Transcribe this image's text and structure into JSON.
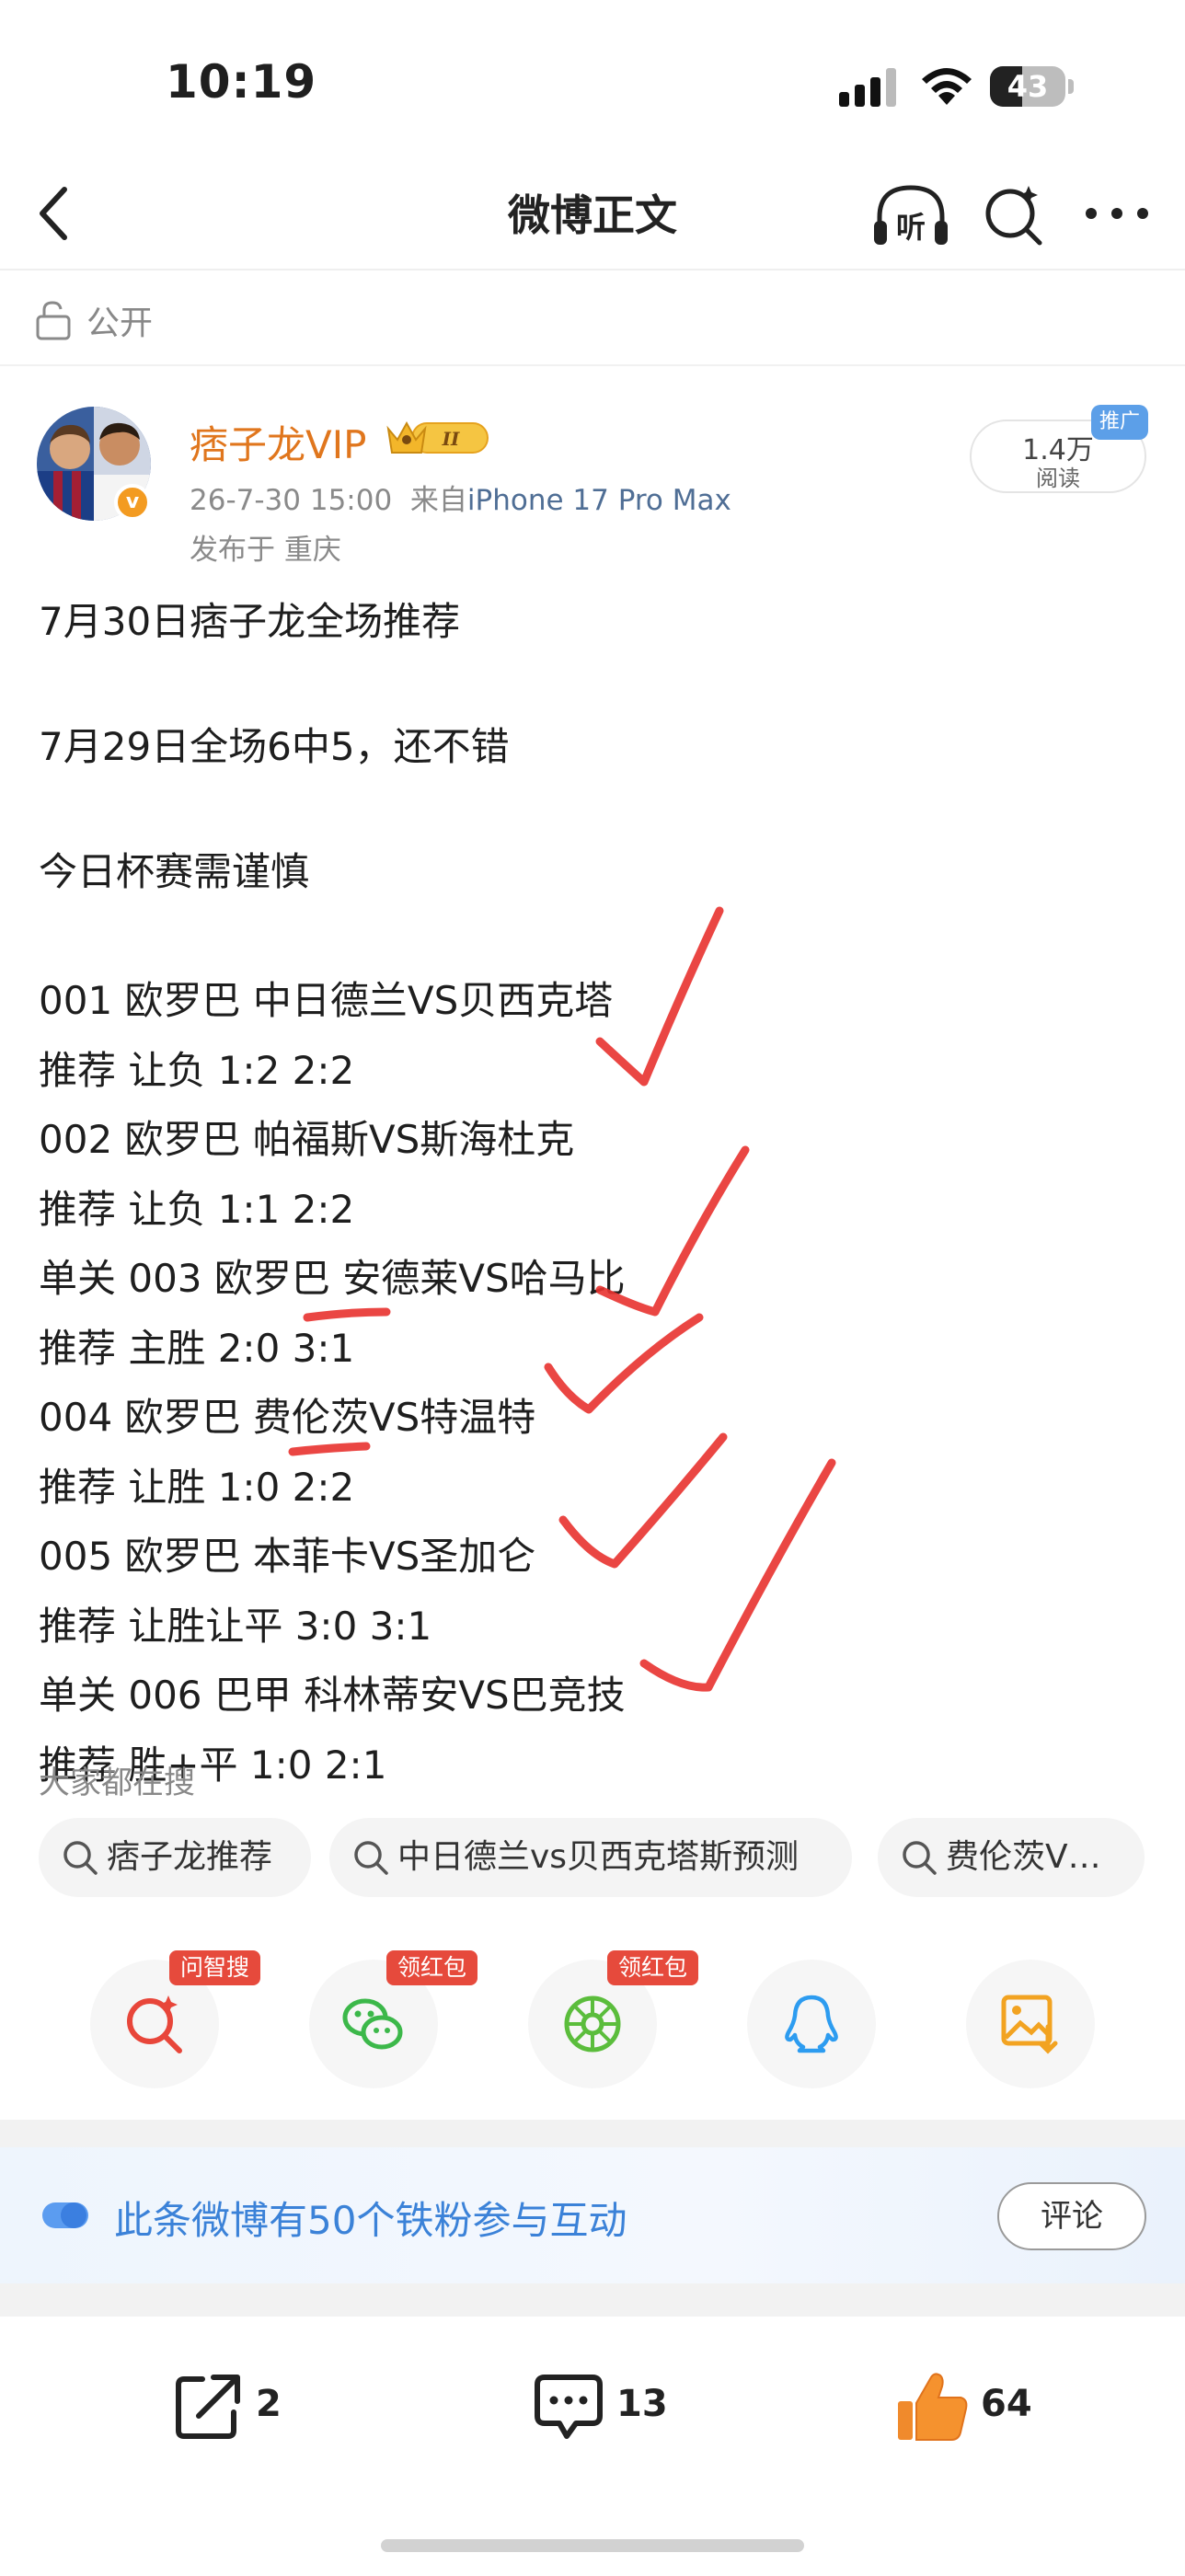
{
  "status_bar": {
    "time": "10:19",
    "battery": "43",
    "battery_level": 0.43
  },
  "nav": {
    "title": "微博正文",
    "listen_label": "听",
    "icons": [
      "back-chevron-icon",
      "listen-icon",
      "ai-search-icon",
      "more-icon"
    ]
  },
  "visibility": {
    "label": "公开",
    "icon": "lock-open-icon"
  },
  "author": {
    "name": "痞子龙VIP",
    "vip_level": "II",
    "date": "26-7-30 15:00",
    "source_prefix": "来自",
    "device": "iPhone 17 Pro Max",
    "location": "发布于 重庆",
    "verified": "v",
    "views_count": "1.4万",
    "views_label": "阅读",
    "promo_tag": "推广"
  },
  "post": {
    "lines": [
      "7月30日痞子龙全场推荐",
      "",
      "7月29日全场6中5，还不错",
      "",
      "今日杯赛需谨慎",
      "",
      "001 欧罗巴 中日德兰VS贝西克塔",
      "推荐 让负 1:2 2:2",
      "002 欧罗巴 帕福斯VS斯海杜克",
      "推荐 让负 1:1 2:2",
      "单关 003 欧罗巴 安德莱VS哈马比",
      "推荐 主胜 2:0 3:1",
      "004 欧罗巴 费伦茨VS特温特",
      "推荐 让胜 1:0 2:2",
      "005 欧罗巴 本菲卡VS圣加仑",
      "推荐 让胜让平 3:0 3:1",
      "单关 006 巴甲 科林蒂安VS巴竞技",
      "推荐 胜+平 1:0 2:1"
    ]
  },
  "hot_search": {
    "title": "大家都在搜",
    "chips": [
      "痞子龙推荐",
      "中日德兰vs贝西克塔斯预测",
      "费伦茨V…"
    ]
  },
  "share": {
    "buttons": [
      {
        "icon": "ai-search-icon",
        "tag": "问智搜",
        "color": "#e8463a"
      },
      {
        "icon": "wechat-icon",
        "tag": "领红包",
        "color": "#3cb84a"
      },
      {
        "icon": "moments-icon",
        "tag": "领红包",
        "color": "#5bbd3c"
      },
      {
        "icon": "qq-icon",
        "tag": "",
        "color": "#2d9cf0"
      },
      {
        "icon": "save-image-icon",
        "tag": "",
        "color": "#f2a321"
      }
    ]
  },
  "fan_banner": {
    "text": "此条微博有50个铁粉参与互动",
    "button": "评论"
  },
  "actions": {
    "repost": "2",
    "comment": "13",
    "like": "64"
  }
}
